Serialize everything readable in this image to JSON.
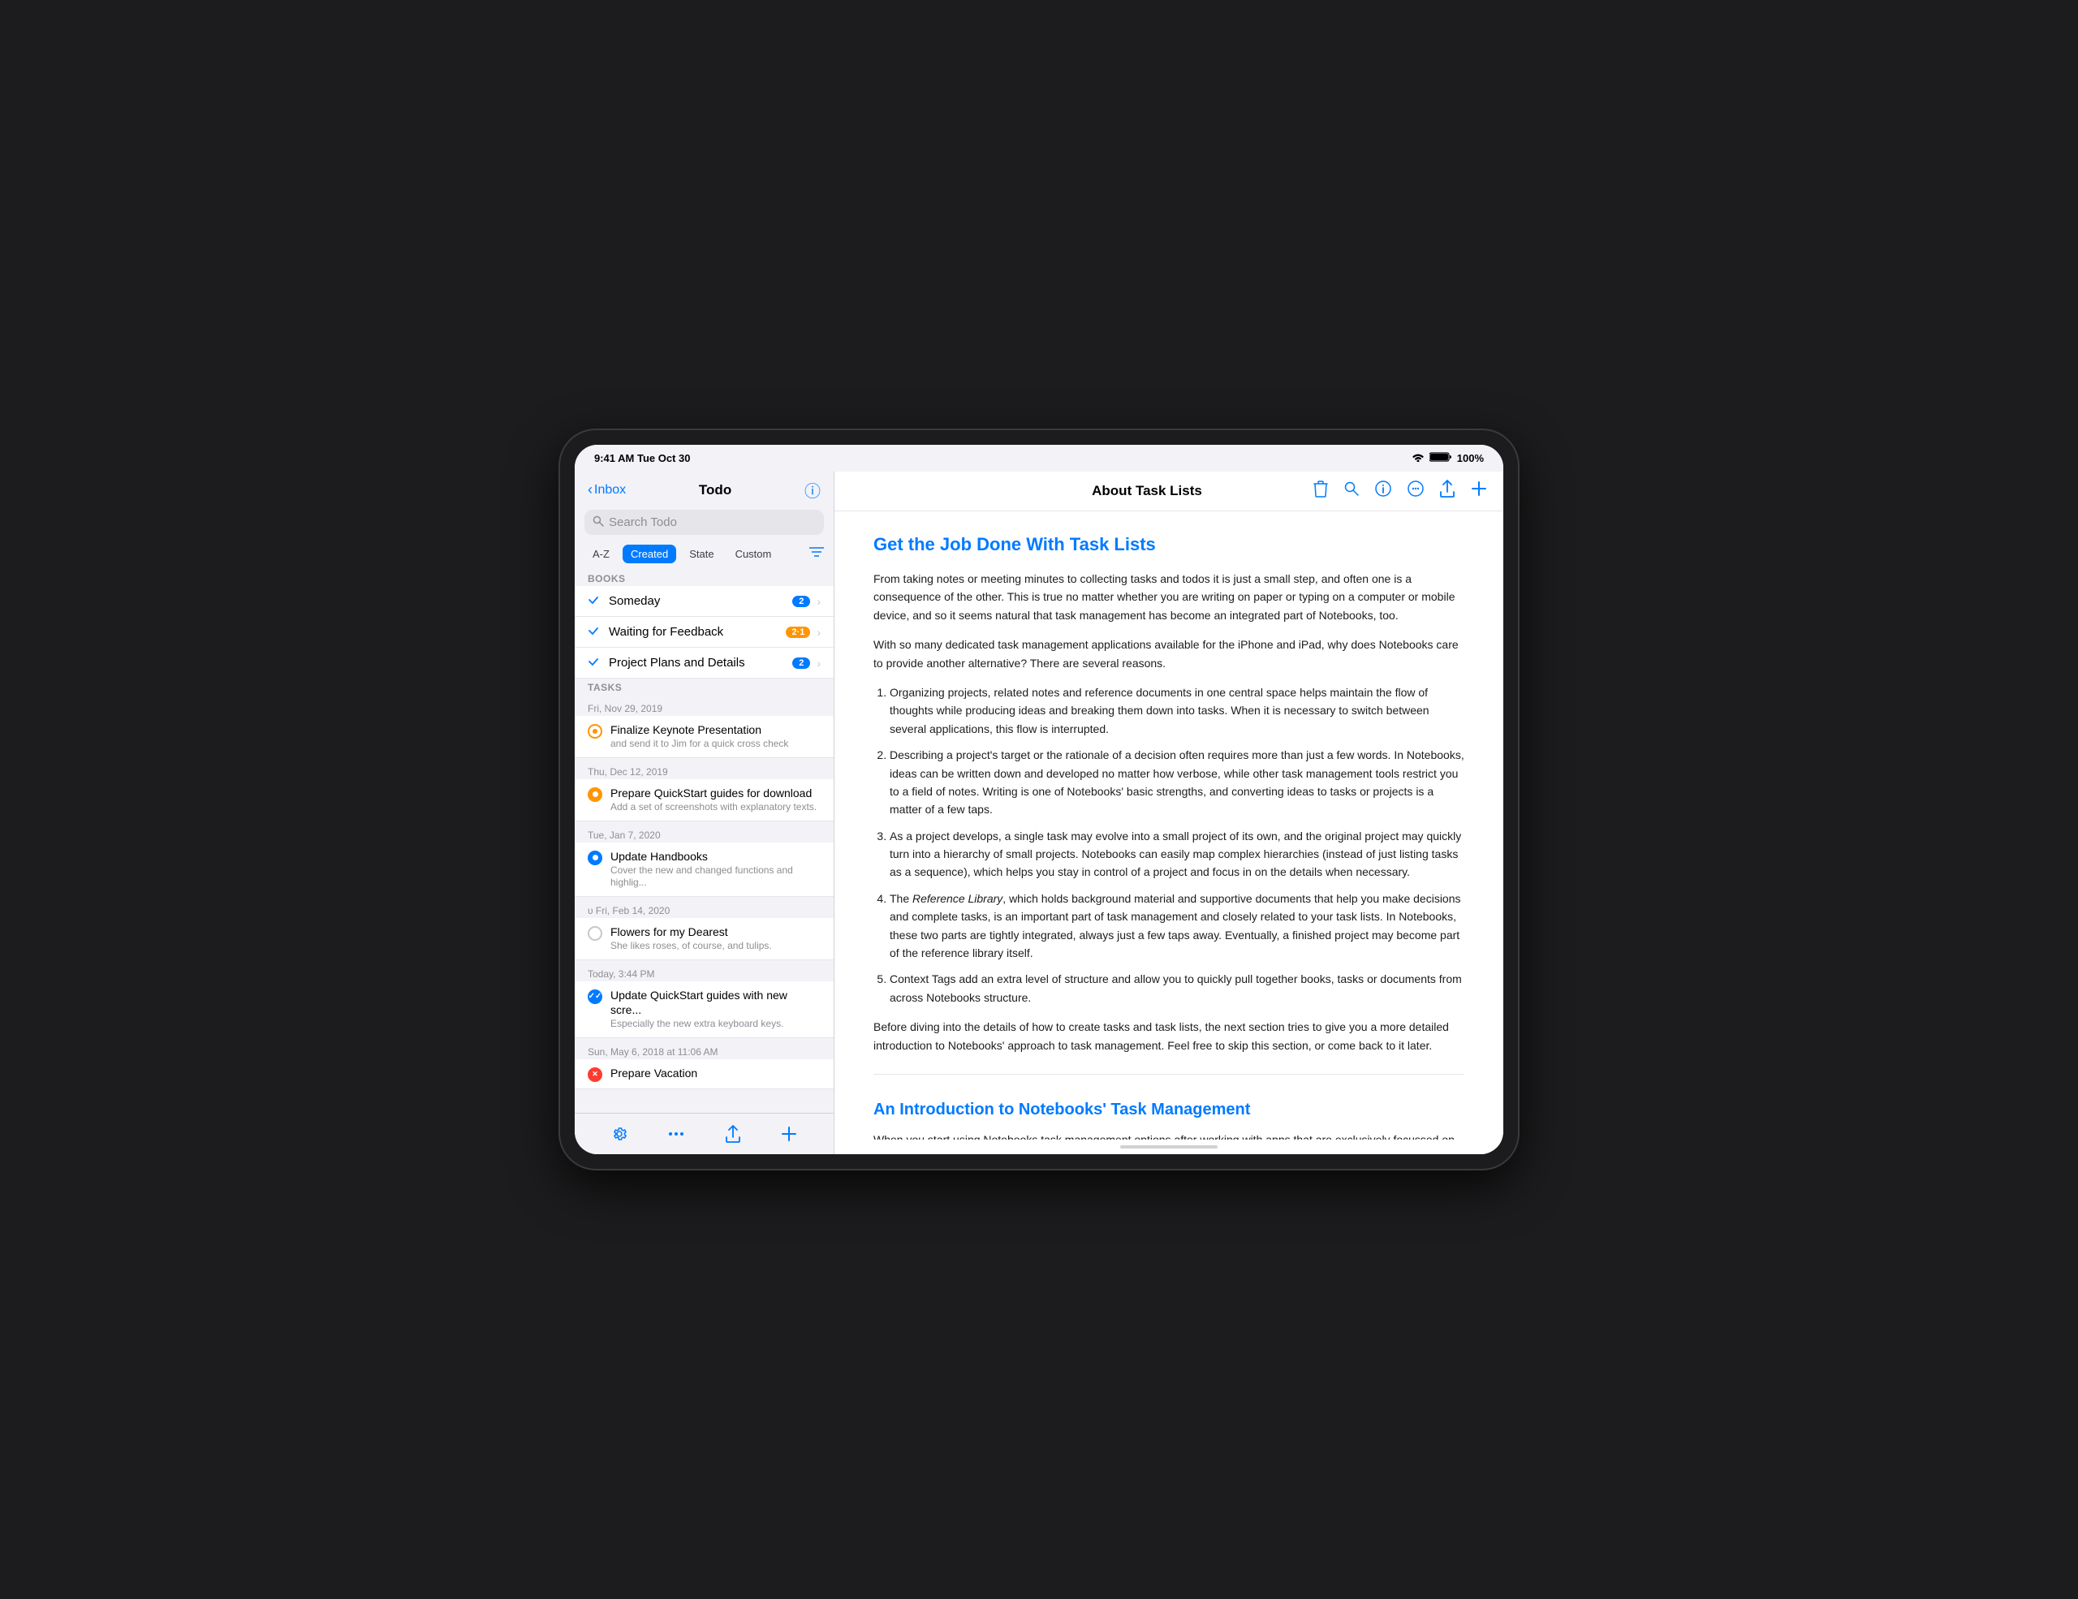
{
  "status_bar": {
    "time": "9:41 AM  Tue Oct 30",
    "battery": "100%",
    "wifi": "WiFi"
  },
  "sidebar": {
    "back_label": "Inbox",
    "title": "Todo",
    "info_icon": "ℹ",
    "search_placeholder": "Search Todo",
    "sort_buttons": [
      {
        "label": "A-Z",
        "active": false
      },
      {
        "label": "Created",
        "active": true
      },
      {
        "label": "State",
        "active": false
      },
      {
        "label": "Custom",
        "active": false
      }
    ],
    "filter_icon": "≡",
    "books_section_label": "BOOKS",
    "books": [
      {
        "name": "Someday",
        "badge": "2",
        "badge_color": "blue"
      },
      {
        "name": "Waiting for Feedback",
        "badge": "2·1",
        "badge_color": "orange"
      },
      {
        "name": "Project Plans and Details",
        "badge": "2",
        "badge_color": "blue"
      }
    ],
    "tasks_section_label": "TASKS",
    "tasks": [
      {
        "date": "Fri, Nov 29, 2019",
        "title": "Finalize Keynote Presentation",
        "subtitle": "and send it to Jim for a quick cross check",
        "circle_type": "orange-dot"
      },
      {
        "date": "Thu, Dec 12, 2019",
        "title": "Prepare QuickStart guides for download",
        "subtitle": "Add a set of screenshots with explanatory texts.",
        "circle_type": "orange-filled"
      },
      {
        "date": "Tue, Jan 7, 2020",
        "title": "Update Handbooks",
        "subtitle": "Cover the new and changed functions and highlig...",
        "circle_type": "blue-filled"
      },
      {
        "date": "υ Fri, Feb 14, 2020",
        "title": "Flowers for my Dearest",
        "subtitle": "She likes roses, of course, and tulips.",
        "circle_type": "empty"
      },
      {
        "date": "Today, 3:44 PM",
        "title": "Update QuickStart guides with new scre...",
        "subtitle": "Especially the new extra keyboard keys.",
        "circle_type": "checked"
      },
      {
        "date": "Sun, May 6, 2018 at 11:06 AM",
        "title": "Prepare Vacation",
        "subtitle": "",
        "circle_type": "x-mark"
      }
    ],
    "toolbar_icons": [
      "gear",
      "ellipsis",
      "share",
      "plus"
    ]
  },
  "detail": {
    "title": "About Task Lists",
    "toolbar_icons": [
      "trash",
      "search",
      "info",
      "ellipsis",
      "share",
      "plus"
    ],
    "article": {
      "h1": "Get the Job Done With Task Lists",
      "intro_p1": "From taking notes or meeting minutes to collecting tasks and todos it is just a small step, and often one is a consequence of the other. This is true no matter whether you are writing on paper or typing on a computer or mobile device, and so it seems natural that task management has become an integrated part of Notebooks, too.",
      "intro_p2": "With so many dedicated task management applications available for the iPhone and iPad, why does Notebooks care to provide another alternative? There are several reasons.",
      "list_items": [
        "Organizing projects, related notes and reference documents in one central space helps maintain the flow of thoughts while producing ideas and breaking them down into tasks. When it is necessary to switch between several applications, this flow is interrupted.",
        "Describing a project's target or the rationale of a decision often requires more than just a few words. In Notebooks, ideas can be written down and developed no matter how verbose, while other task management tools restrict you to a field of notes. Writing is one of Notebooks' basic strengths, and converting ideas to tasks or projects is a matter of a few taps.",
        "As a project develops, a single task may evolve into a small project of its own, and the original project may quickly turn into a hierarchy of small projects. Notebooks can easily map complex hierarchies (instead of just listing tasks as a sequence), which helps you stay in control of a project and focus in on the details when necessary.",
        "The Reference Library, which holds background material and supportive documents that help you make decisions and complete tasks, is an important part of task management and closely related to your task lists. In Notebooks, these two parts are tightly integrated, always just a few taps away. Eventually, a finished project may become part of the reference library itself.",
        "Context Tags add an extra level of structure and allow you to quickly pull together books, tasks or documents from across Notebooks structure."
      ],
      "closing_p": "Before diving into the details of how to create tasks and task lists, the next section tries to give you a more detailed introduction to Notebooks' approach to task management. Feel free to skip this section, or come back to it later.",
      "h2": "An Introduction to Notebooks' Task Management",
      "body_p": "When you start using Notebooks task management options after working with apps that are exclusively focussed on getting things done, you may feel surprised by Notebooks' flexibility: you can turn a regular book into a task list, and all items you add to that book - short notes, multi page documents, photos, PDF documents - show up as tasks. Notebooks does not force you to add details or attributes to your tasks, but you can assign due dates and alert times if you want. Notebooks may even automatically populate task lists for, if you choose. Regular books and task lists can exist anywhere within Notebooks, and you can even keep regular documents as part of task lists."
    }
  }
}
